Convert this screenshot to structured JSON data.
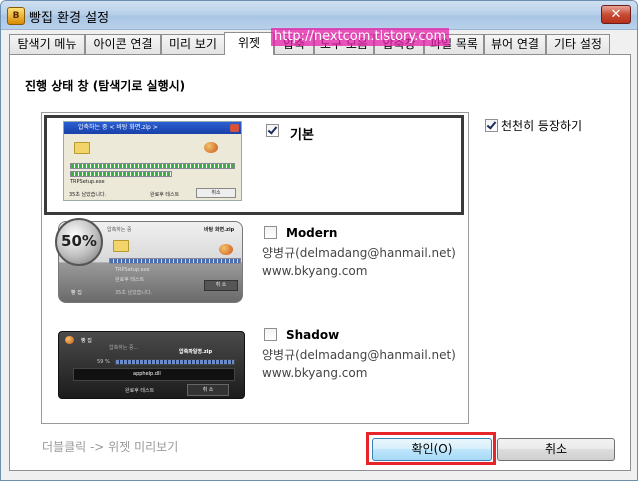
{
  "window": {
    "title": "빵집 환경 설정",
    "icon": "bakery-app-icon",
    "close_symbol": "✕"
  },
  "tabs": [
    {
      "label": "탐색기 메뉴",
      "active": false
    },
    {
      "label": "아이콘 연결",
      "active": false
    },
    {
      "label": "미리 보기",
      "active": false
    },
    {
      "label": "위젯",
      "active": true
    },
    {
      "label": "압축",
      "active": false
    },
    {
      "label": "도구 모음",
      "active": false
    },
    {
      "label": "압축창",
      "active": false
    },
    {
      "label": "파일 목록",
      "active": false
    },
    {
      "label": "뷰어 연결",
      "active": false
    },
    {
      "label": "기타 설정",
      "active": false
    }
  ],
  "watermark": "http://nextcom.tistory.com",
  "section_title": "진행 상태 창 (탐색기로 실행시)",
  "skins": [
    {
      "name": "기본",
      "checked": true,
      "selected": true,
      "author": "",
      "site": "",
      "preview": {
        "title": "압축하는 중 < 바탕 화면.zip >",
        "file": "TRPSetup.exe",
        "remaining": "35초 남았습니다.",
        "checkbox": "완료후 테스트",
        "cancel": "취소"
      }
    },
    {
      "name": "Modern",
      "checked": false,
      "selected": false,
      "author": "양병규(delmadang@hanmail.net)",
      "site": "www.bkyang.com",
      "preview": {
        "percent": "50%",
        "title": "압축하는 중",
        "archive": "바탕 화면.zip",
        "file": "TRPSetup.exe",
        "checkbox": "완료후 테스트",
        "remaining": "35초 남았습니다.",
        "cancel": "취 소",
        "brand": "빵 집"
      }
    },
    {
      "name": "Shadow",
      "checked": false,
      "selected": false,
      "author": "양병규(delmadang@hanmail.net)",
      "site": "www.bkyang.com",
      "preview": {
        "brand": "빵 집",
        "title": "압축하는 중...",
        "archive": "압축파일명.zip",
        "percent": "59 %",
        "file": "apphelp.dll",
        "checkbox": "완료후 테스트",
        "cancel": "취 소"
      }
    }
  ],
  "slow_appear": {
    "label": "천천히 등장하기",
    "checked": true
  },
  "status_hint": "더블클릭 -> 위젯 미리보기",
  "buttons": {
    "ok": "확인(O)",
    "cancel": "취소"
  },
  "colors": {
    "highlight_border": "#e8242b",
    "watermark_bg": "#e61eaa",
    "progress_green": "#3cb043"
  }
}
